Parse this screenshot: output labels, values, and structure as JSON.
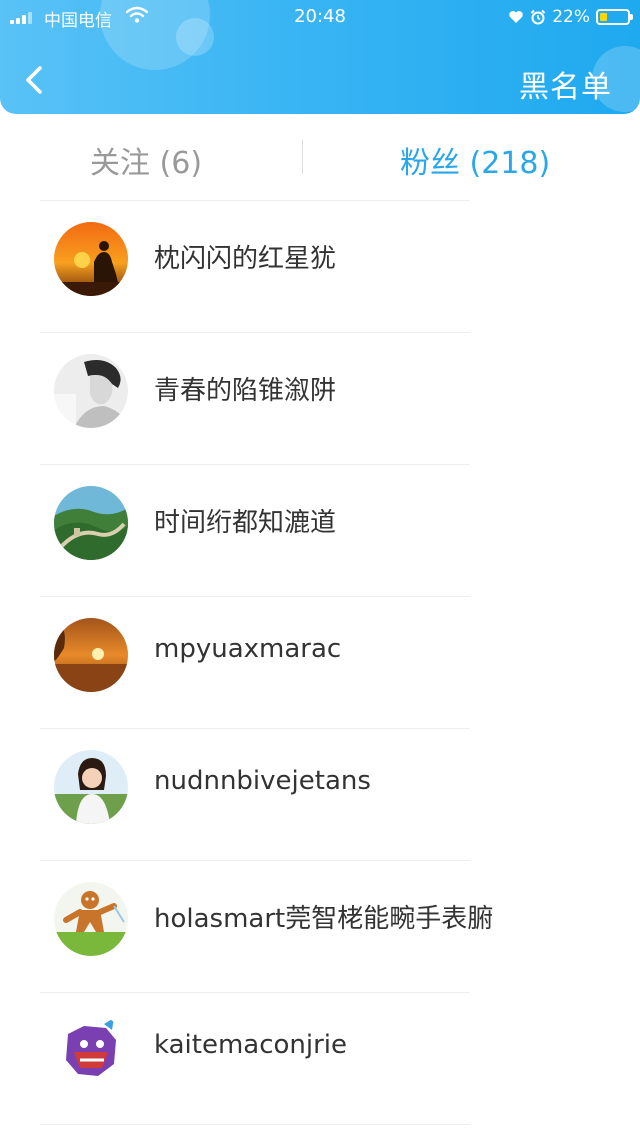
{
  "status_bar": {
    "carrier": "中国电信",
    "time": "20:48",
    "battery": "22%",
    "battery_level": 0.22
  },
  "header": {
    "right_action": "黑名单",
    "back_icon": "chevron-left-icon"
  },
  "tabs": [
    {
      "label": "关注 (6)",
      "active": false
    },
    {
      "label": "粉丝 (218)",
      "active": true
    }
  ],
  "fans": [
    {
      "name": "枕闪闪的红星犹",
      "avatar": "buddha-sunset-avatar"
    },
    {
      "name": "青春的陷锥溆阱",
      "avatar": "portrait-bw-avatar"
    },
    {
      "name": "时间绗都知漉道",
      "avatar": "great-wall-avatar"
    },
    {
      "name": "mpyuaxmarac",
      "avatar": "sunset-avatar"
    },
    {
      "name": "nudnnbivejetans",
      "avatar": "girl-avatar"
    },
    {
      "name": "holasmart莞智栳能畹手表腑",
      "avatar": "gingerbread-avatar"
    },
    {
      "name": "kaitemaconjrie",
      "avatar": "cartoon-monster-avatar"
    }
  ]
}
